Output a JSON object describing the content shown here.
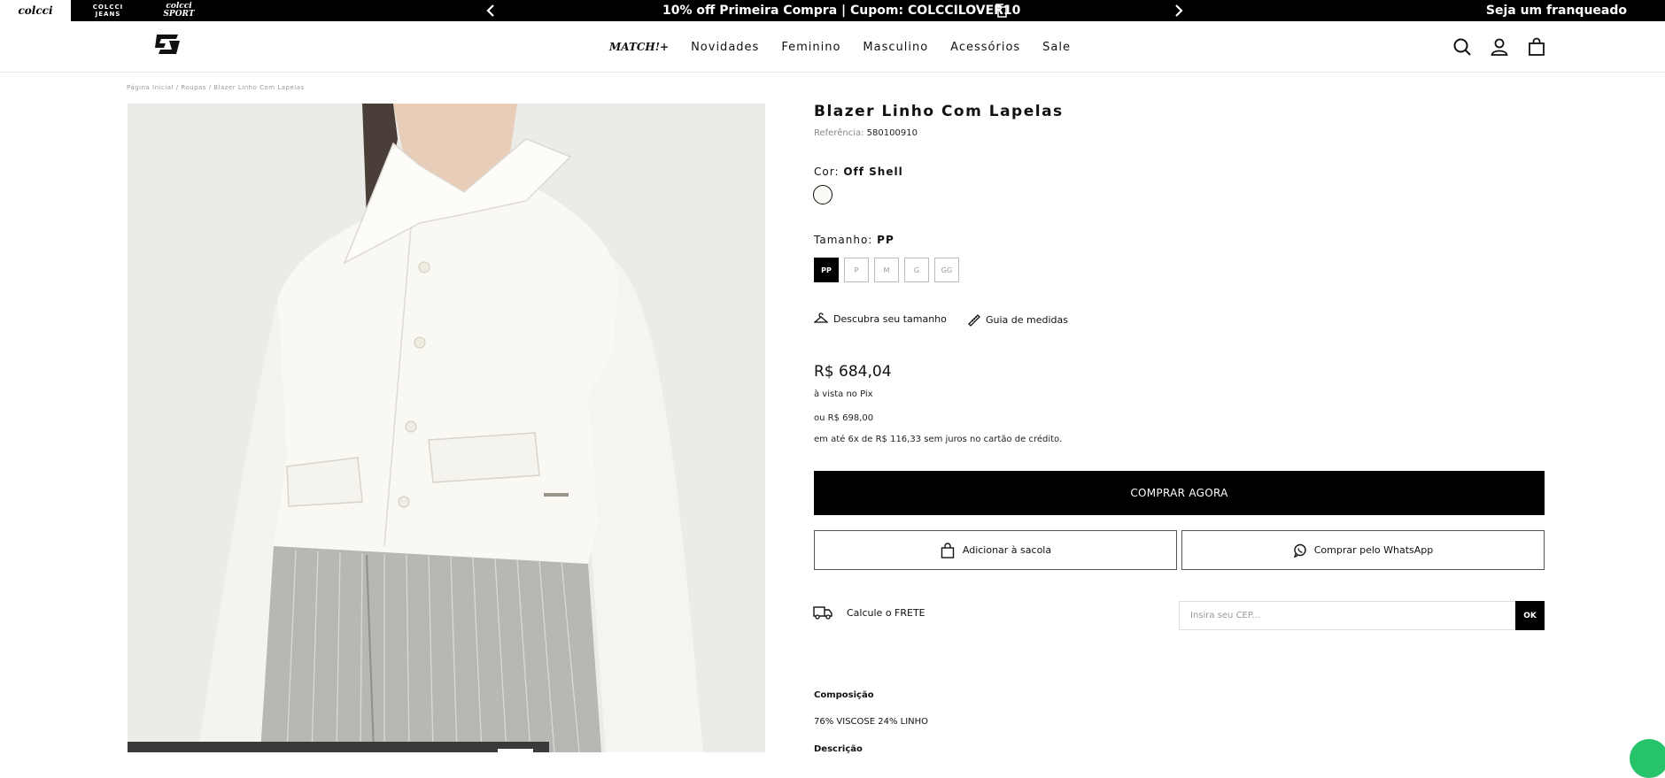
{
  "topbar": {
    "brands": [
      "colcci",
      "COLCCI",
      "JEANS",
      "colcci",
      "SPORT"
    ],
    "announcement": "10% off Primeira Compra | Cupom: COLCCILOVER10",
    "franchise": "Seja um franqueado"
  },
  "header": {
    "nav": [
      "MATCH!+",
      "Novidades",
      "Feminino",
      "Masculino",
      "Acessórios",
      "Sale"
    ]
  },
  "breadcrumb": "Página Inicial / Roupas / Blazer Linho Com Lapelas",
  "product": {
    "title": "Blazer Linho Com Lapelas",
    "ref_label": "Referência:",
    "ref_value": "580100910",
    "color_label": "Cor:",
    "color_value": "Off Shell",
    "size_label": "Tamanho:",
    "size_value": "PP",
    "sizes": [
      "PP",
      "P",
      "M",
      "G",
      "GG"
    ],
    "find_size": "Descubra seu tamanho",
    "size_guide": "Guia de medidas",
    "price": "R$ 684,04",
    "price_note": "à vista no Pix",
    "alt_price": "ou R$ 698,00",
    "installments": "em até 6x de R$ 116,33 sem juros no cartão de crédito.",
    "buy_now": "COMPRAR AGORA",
    "add_bag": "Adicionar à sacola",
    "whatsapp": "Comprar pelo WhatsApp",
    "shipping_label": "Calcule o FRETE",
    "cep_placeholder": "Insira seu CEP...",
    "cep_button": "OK",
    "composition_title": "Composição",
    "composition_text": "76% VISCOSE 24% LINHO",
    "description_title": "Descrição"
  }
}
